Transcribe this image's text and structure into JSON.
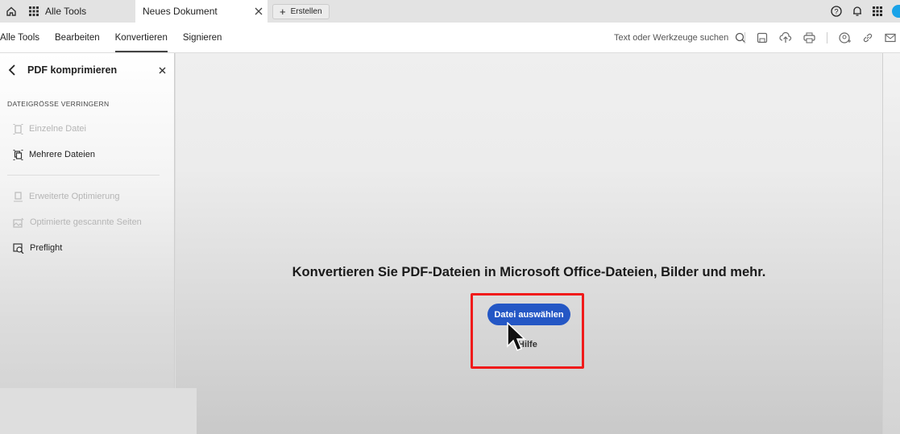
{
  "tabbar": {
    "home_icon": "home-icon",
    "apps_tab": "Alle Tools",
    "document_tab": "Neues Dokument",
    "create_button": "Erstellen"
  },
  "menubar": {
    "items": [
      {
        "label": "Alle Tools"
      },
      {
        "label": "Bearbeiten"
      },
      {
        "label": "Konvertieren",
        "active": true
      },
      {
        "label": "Signieren"
      }
    ],
    "search_placeholder": "Text oder Werkzeuge suchen"
  },
  "sidebar": {
    "title": "PDF komprimieren",
    "section": "DATEIGRÖSSE VERRINGERN",
    "items": [
      {
        "label": "Einzelne Datei",
        "disabled": true
      },
      {
        "label": "Mehrere Dateien",
        "disabled": false
      },
      {
        "label": "Erweiterte Optimierung",
        "disabled": true
      },
      {
        "label": "Optimierte gescannte Seiten",
        "disabled": true
      },
      {
        "label": "Preflight",
        "disabled": false
      }
    ]
  },
  "main": {
    "headline": "Konvertieren Sie PDF-Dateien in Microsoft Office-Dateien, Bilder und mehr.",
    "primary_button": "Datei auswählen",
    "help_link": "Hilfe"
  },
  "colors": {
    "accent": "#2457c5",
    "highlight": "#f01a1a"
  }
}
